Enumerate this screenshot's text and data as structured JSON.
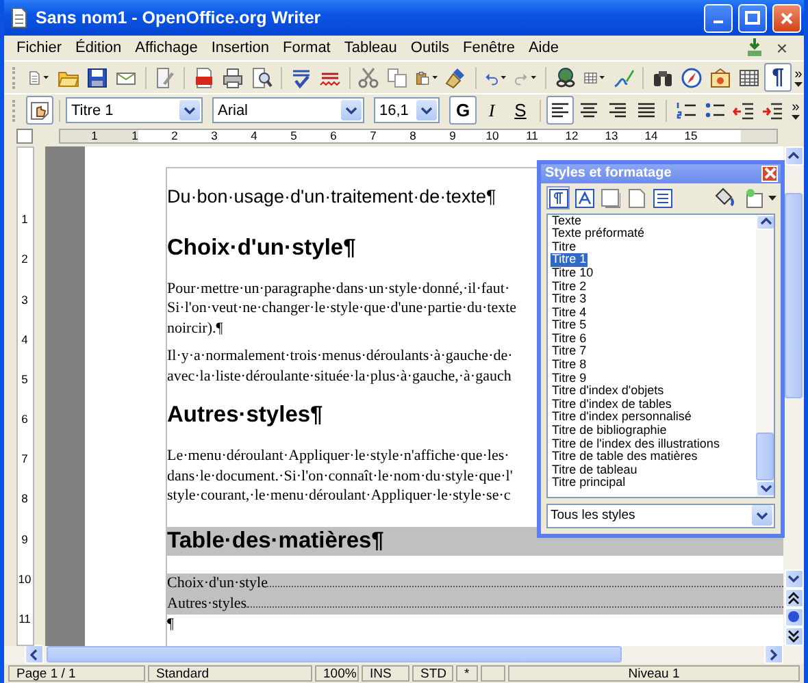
{
  "window": {
    "title": "Sans nom1 - OpenOffice.org Writer"
  },
  "menu": [
    "Fichier",
    "Édition",
    "Affichage",
    "Insertion",
    "Format",
    "Tableau",
    "Outils",
    "Fenêtre",
    "Aide"
  ],
  "menu_close": "×",
  "toolbar_overflow": [
    "»",
    "»"
  ],
  "formatting_marks": {
    "label": "¶",
    "on": true
  },
  "formatting": {
    "style": "Titre 1",
    "font": "Arial",
    "size": "16,1",
    "bold": "G",
    "italic": "I",
    "shadow": "S"
  },
  "alignment": [
    {
      "kind": "left",
      "selected": true
    },
    {
      "kind": "center",
      "selected": false
    },
    {
      "kind": "right",
      "selected": false
    },
    {
      "kind": "justify",
      "selected": false
    }
  ],
  "ruler": {
    "marks": [
      "1",
      "1",
      "2",
      "3",
      "4",
      "5",
      "6",
      "7",
      "8",
      "9",
      "10",
      "11",
      "12",
      "13",
      "14",
      "15"
    ]
  },
  "vertical_ruler": {
    "marks": [
      "1",
      "2",
      "3",
      "4",
      "5",
      "6",
      "7",
      "8",
      "9",
      "10",
      "11"
    ]
  },
  "document": {
    "blocks": [
      {
        "kind": "title",
        "text": "Du·bon·usage·d'un·traitement·de·texte¶"
      },
      {
        "kind": "heading",
        "text": "Choix·d'un·style¶"
      },
      {
        "kind": "body",
        "lines": [
          "Pour·mettre·un·paragraphe·dans·un·style·donné,·il·faut·",
          "Si·l'on·veut·ne·changer·le·style·que·d'une·partie·du·texte",
          "noircir).¶"
        ]
      },
      {
        "kind": "body",
        "lines": [
          "Il·y·a·normalement·trois·menus·déroulants·à·gauche·de·",
          "avec·la·liste·déroulante·située·la·plus·à·gauche,·à·gauch"
        ]
      },
      {
        "kind": "heading",
        "text": "Autres·styles¶"
      },
      {
        "kind": "body",
        "lines": [
          "Le·menu·déroulant·Appliquer·le·style·n'affiche·que·les·",
          "dans·le·document.·Si·l'on·connaît·le·nom·du·style·que·l'",
          "style·courant,·le·menu·déroulant·Appliquer·le·style·se·c"
        ]
      },
      {
        "kind": "toc_heading",
        "text": "Table·des·matières¶"
      },
      {
        "kind": "toc_entry",
        "text": "Choix·d'un·style"
      },
      {
        "kind": "toc_entry",
        "text": "Autres·styles"
      },
      {
        "kind": "mark",
        "text": "¶"
      }
    ]
  },
  "styles_panel": {
    "title": "Styles et formatage",
    "categories": [
      {
        "selected": true
      },
      {
        "selected": false
      },
      {
        "selected": false
      },
      {
        "selected": false
      },
      {
        "selected": false
      }
    ],
    "items": [
      {
        "label": "Texte",
        "selected": false
      },
      {
        "label": "Texte préformaté",
        "selected": false
      },
      {
        "label": "Titre",
        "selected": false
      },
      {
        "label": "Titre 1",
        "selected": true
      },
      {
        "label": "Titre 10",
        "selected": false
      },
      {
        "label": "Titre 2",
        "selected": false
      },
      {
        "label": "Titre 3",
        "selected": false
      },
      {
        "label": "Titre 4",
        "selected": false
      },
      {
        "label": "Titre 5",
        "selected": false
      },
      {
        "label": "Titre 6",
        "selected": false
      },
      {
        "label": "Titre 7",
        "selected": false
      },
      {
        "label": "Titre 8",
        "selected": false
      },
      {
        "label": "Titre 9",
        "selected": false
      },
      {
        "label": "Titre d'index d'objets",
        "selected": false
      },
      {
        "label": "Titre d'index de tables",
        "selected": false
      },
      {
        "label": "Titre d'index personnalisé",
        "selected": false
      },
      {
        "label": "Titre de bibliographie",
        "selected": false
      },
      {
        "label": "Titre de l'index des illustrations",
        "selected": false
      },
      {
        "label": "Titre de table des matières",
        "selected": false
      },
      {
        "label": "Titre de tableau",
        "selected": false
      },
      {
        "label": "Titre principal",
        "selected": false
      }
    ],
    "filter": "Tous les styles"
  },
  "status_bar": [
    "Page 1 / 1",
    "Standard",
    "100%",
    "INS",
    "STD",
    "*",
    "Niveau 1"
  ]
}
